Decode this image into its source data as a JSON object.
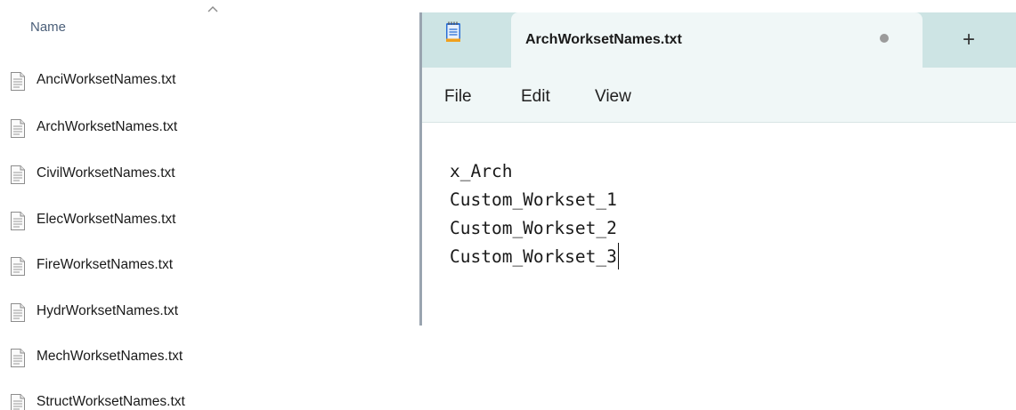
{
  "explorer": {
    "column_header": "Name",
    "files": [
      {
        "name": "AnciWorksetNames.txt",
        "icon": "text-file-icon"
      },
      {
        "name": "ArchWorksetNames.txt",
        "icon": "text-file-icon"
      },
      {
        "name": "CivilWorksetNames.txt",
        "icon": "text-file-icon"
      },
      {
        "name": "ElecWorksetNames.txt",
        "icon": "text-file-icon"
      },
      {
        "name": "FireWorksetNames.txt",
        "icon": "text-file-icon"
      },
      {
        "name": "HydrWorksetNames.txt",
        "icon": "text-file-icon"
      },
      {
        "name": "MechWorksetNames.txt",
        "icon": "text-file-icon"
      },
      {
        "name": "StructWorksetNames.txt",
        "icon": "text-file-icon"
      }
    ]
  },
  "notepad": {
    "tab_title": "ArchWorksetNames.txt",
    "unsaved_indicator": "dot",
    "new_tab_label": "+",
    "menu": {
      "file": "File",
      "edit": "Edit",
      "view": "View"
    },
    "content_lines": [
      "x_Arch",
      "Custom_Workset_1",
      "Custom_Workset_2",
      "Custom_Workset_3"
    ],
    "colors": {
      "tabbar_bg": "#cde4e4",
      "tab_bg": "#f0f7f7"
    }
  }
}
